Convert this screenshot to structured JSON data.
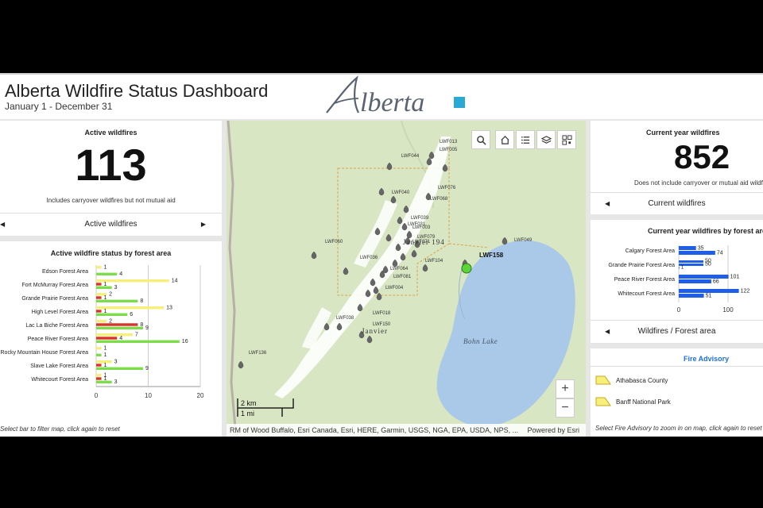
{
  "header": {
    "title": "Alberta Wildfire Status Dashboard",
    "subtitle": "January 1 - December 31",
    "logo_text": "Alberta"
  },
  "active": {
    "title": "Active wildfires",
    "count": "113",
    "note": "Includes carryover wildfires but not mutual aid",
    "nav_label": "Active wildfires"
  },
  "status_chart": {
    "title": "Active wildfire status by forest area",
    "footnote": "Select bar to filter map, click again to reset"
  },
  "map": {
    "attribution": "RM of Wood Buffalo, Esri Canada, Esri, HERE, Garmin, USGS, NGA, EPA, USDA, NPS, ...",
    "powered_by": "Powered by Esri",
    "scale_km": "2 km",
    "scale_mi": "1 mi",
    "lake_label": "Bohn Lake",
    "town_label_1": "Janvier 194",
    "town_label_2": "Janvier",
    "highlight_label": "LWF158",
    "fire_labels": [
      "LWF013",
      "LWF005",
      "LWF044",
      "LWF076",
      "LWF040",
      "LWF068",
      "LWF039",
      "LWF031",
      "LWF003",
      "LWF079",
      "LWF060",
      "LWF071",
      "LWF049",
      "LWF036",
      "LWF104",
      "LWF064",
      "LWF081",
      "LWF004",
      "LWF018",
      "LWF038",
      "LWF150",
      "LWF136"
    ],
    "zoom_in": "+",
    "zoom_out": "−"
  },
  "current": {
    "title": "Current year wildfires",
    "count": "852",
    "note": "Does not include carryover or mutual aid wildfi",
    "nav_label": "Current wildfires"
  },
  "forest_chart": {
    "title": "Current year wildfires by forest area",
    "nav_label": "Wildfires / Forest area"
  },
  "advisory": {
    "title": "Fire Advisory",
    "items": [
      "Athabasca County",
      "Banff National Park"
    ],
    "footnote": "Select Fire Advisory to zoom in on map, click again to reset m"
  },
  "colors": {
    "yellow": "#f6f07a",
    "red": "#d9342b",
    "green": "#7ddc4a",
    "blue": "#1f5fe8",
    "fire_marker": "#666666",
    "highlight_marker": "#5cd43a",
    "water": "#aac8e8",
    "land": "#d8e6c4",
    "ridge": "#ffffff"
  },
  "chart_data": [
    {
      "type": "bar",
      "orientation": "horizontal",
      "title": "Active wildfire status by forest area",
      "categories": [
        "Edson Forest Area",
        "Fort McMurray Forest Area",
        "Grande Prairie Forest Area",
        "High Level Forest Area",
        "Lac La Biche Forest Area",
        "Peace River Forest Area",
        "Rocky Mountain House Forest Area",
        "Slave Lake Forest Area",
        "Whitecourt Forest Area"
      ],
      "series": [
        {
          "color": "#f6f07a",
          "values": [
            1,
            14,
            2,
            13,
            2,
            7,
            1,
            3,
            1
          ]
        },
        {
          "color": "#d9342b",
          "values": [
            0,
            1,
            1,
            1,
            8,
            4,
            0,
            1,
            1
          ]
        },
        {
          "color": "#7ddc4a",
          "values": [
            4,
            3,
            8,
            6,
            9,
            16,
            1,
            9,
            3
          ]
        }
      ],
      "xticks": [
        0,
        10,
        20
      ],
      "xlim": [
        0,
        20
      ],
      "grid": true
    },
    {
      "type": "bar",
      "orientation": "horizontal",
      "title": "Current year wildfires by forest area",
      "categories": [
        "Calgary Forest Area",
        "Grande Prairie Forest Area",
        "Peace River Forest Area",
        "Whitecourt Forest Area"
      ],
      "series": [
        {
          "color": "#1f5fe8",
          "values": [
            [
              35,
              74
            ],
            [
              50,
              50,
              1
            ],
            [
              101,
              66
            ],
            [
              122,
              51
            ]
          ]
        }
      ],
      "xticks": [
        0,
        100
      ],
      "grid": true
    }
  ]
}
